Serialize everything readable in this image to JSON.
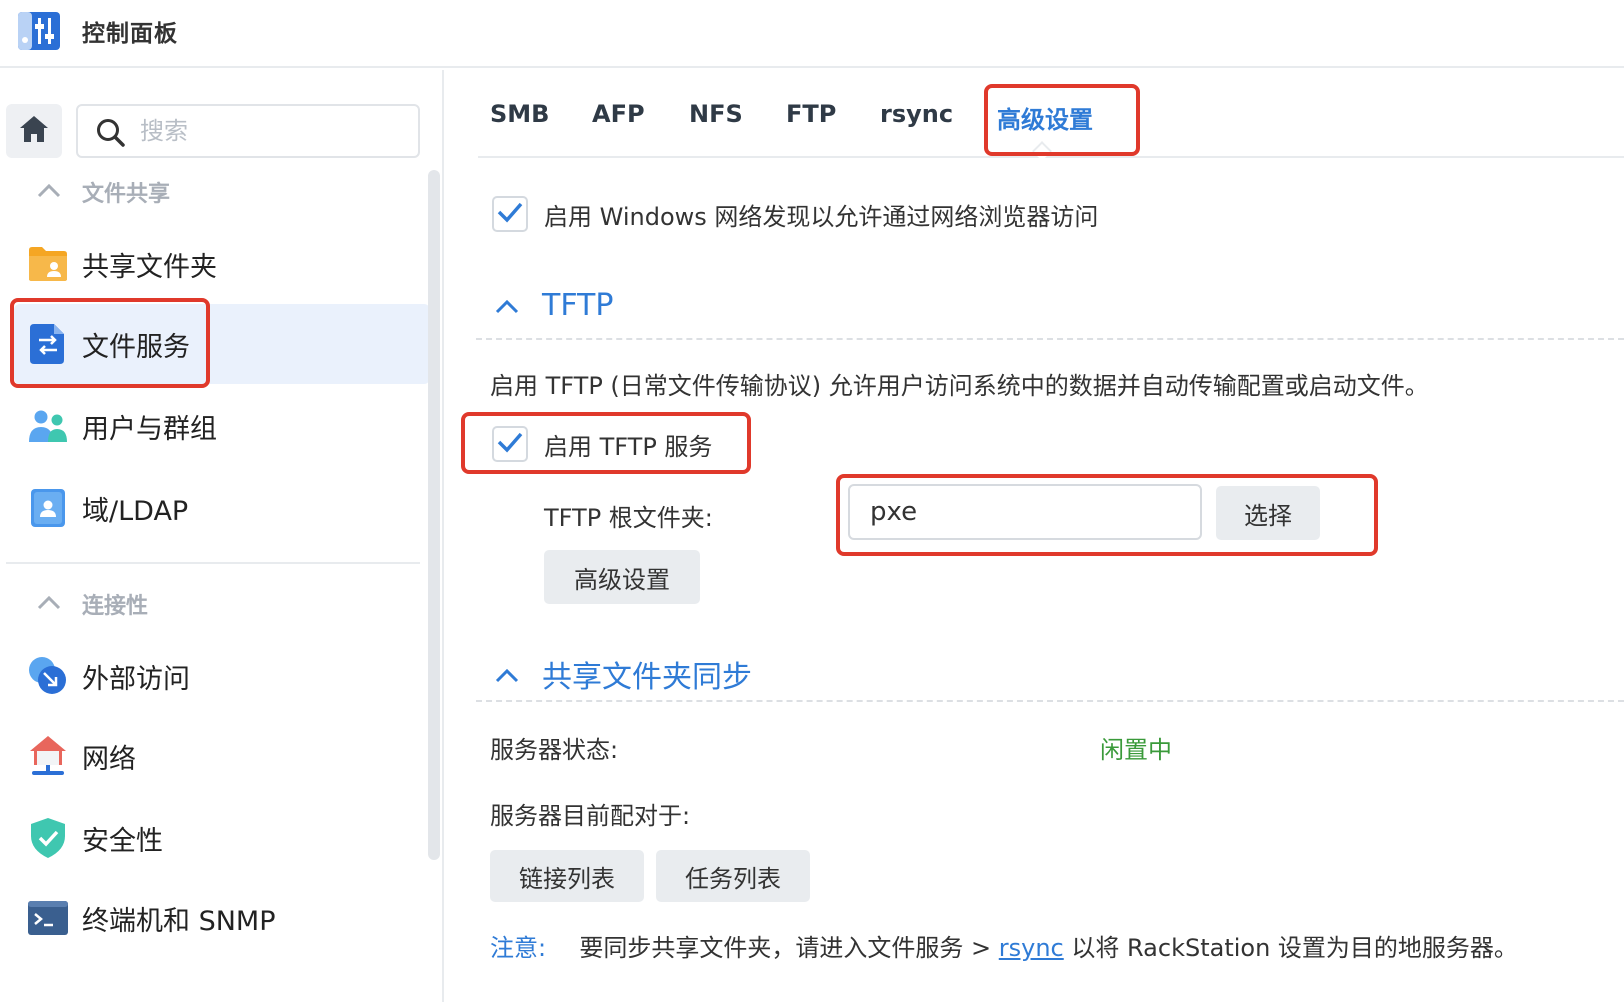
{
  "app": {
    "title": "控制面板"
  },
  "sidebar": {
    "search_placeholder": "搜索",
    "sections": [
      {
        "title": "文件共享",
        "items": [
          {
            "label": "共享文件夹",
            "icon": "shared-folder-icon"
          },
          {
            "label": "文件服务",
            "icon": "file-services-icon",
            "active": true
          },
          {
            "label": "用户与群组",
            "icon": "users-groups-icon"
          },
          {
            "label": "域/LDAP",
            "icon": "domain-ldap-icon"
          }
        ]
      },
      {
        "title": "连接性",
        "items": [
          {
            "label": "外部访问",
            "icon": "external-access-icon"
          },
          {
            "label": "网络",
            "icon": "network-icon"
          },
          {
            "label": "安全性",
            "icon": "security-shield-icon"
          },
          {
            "label": "终端机和 SNMP",
            "icon": "terminal-icon"
          }
        ]
      }
    ]
  },
  "tabs": [
    {
      "label": "SMB"
    },
    {
      "label": "AFP"
    },
    {
      "label": "NFS"
    },
    {
      "label": "FTP"
    },
    {
      "label": "rsync"
    },
    {
      "label": "高级设置",
      "active": true
    }
  ],
  "main": {
    "windows_discovery": {
      "label": "启用 Windows 网络发现以允许通过网络浏览器访问",
      "checked": true
    },
    "tftp": {
      "title": "TFTP",
      "description": "启用 TFTP (日常文件传输协议) 允许用户访问系统中的数据并自动传输配置或启动文件。",
      "enable_label": "启用 TFTP 服务",
      "enable_checked": true,
      "root_label": "TFTP 根文件夹:",
      "root_value": "pxe",
      "select_button": "选择",
      "advanced_button": "高级设置"
    },
    "sync": {
      "title": "共享文件夹同步",
      "status_label": "服务器状态:",
      "status_value": "闲置中",
      "paired_label": "服务器目前配对于:",
      "link_list_button": "链接列表",
      "task_list_button": "任务列表",
      "note_label": "注意:",
      "note_text_1": "要同步共享文件夹，请进入文件服务 >",
      "note_link": "rsync",
      "note_text_2": "以将 RackStation 设置为目的地服务器。"
    }
  },
  "colors": {
    "accent": "#2f7bd6",
    "highlight": "#e0392b",
    "status_ok": "#3a9a3a"
  }
}
